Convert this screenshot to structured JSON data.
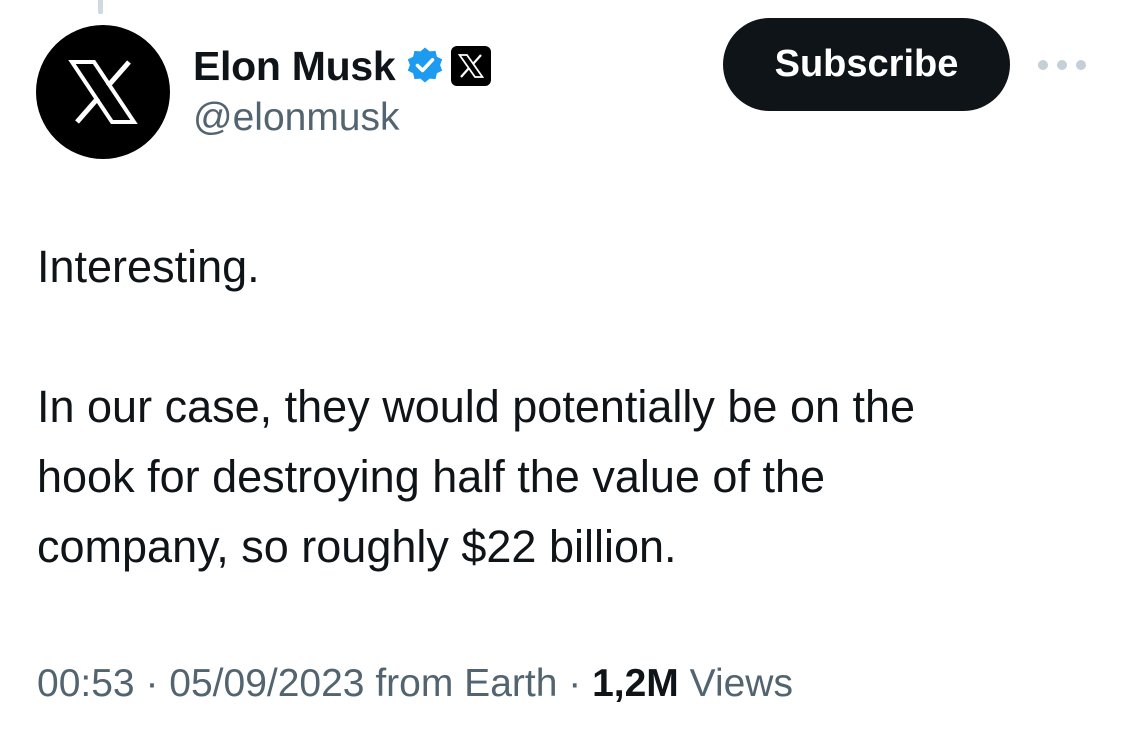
{
  "colors": {
    "text_primary": "#0f1419",
    "text_secondary": "#536471",
    "verified_blue": "#1d9bf0",
    "subscribe_bg": "#0f1419",
    "subscribe_text": "#ffffff"
  },
  "author": {
    "avatar_icon": "x-logo-icon",
    "display_name": "Elon Musk",
    "verified_icon": "verified-badge-icon",
    "affiliate_icon": "x-affiliate-badge-icon",
    "handle": "@elonmusk"
  },
  "actions": {
    "subscribe_label": "Subscribe",
    "more_icon": "more-options-icon"
  },
  "tweet": {
    "paragraph_1": "Interesting.",
    "paragraph_2_lines": [
      "In our case, they would potentially be on the",
      "hook for destroying half the value of the",
      "company, so roughly $22 billion."
    ]
  },
  "meta": {
    "time": "00:53",
    "separator": "·",
    "date": "05/09/2023",
    "source": "from Earth",
    "views_count": "1,2M",
    "views_label": "Views"
  }
}
